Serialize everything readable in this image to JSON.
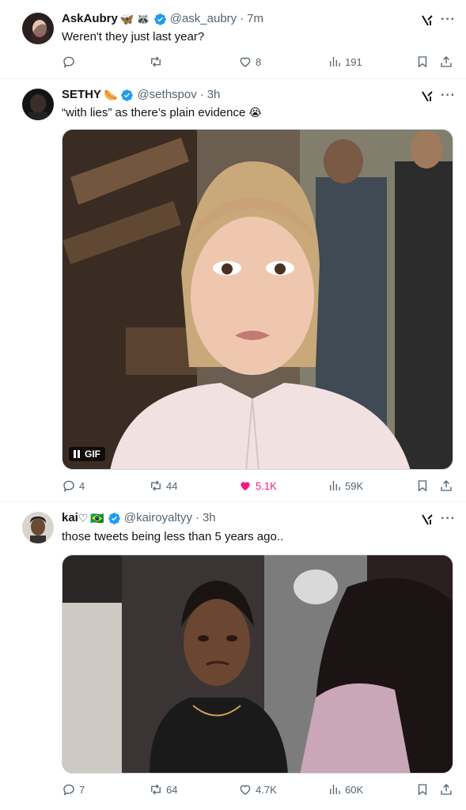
{
  "tweets": [
    {
      "name": "AskAubry",
      "emojis": [
        "🦋",
        "🦝"
      ],
      "handle": "@ask_aubry",
      "time": "7m",
      "text": "Weren't they just last year?",
      "text_emoji": "",
      "replies": "",
      "retweets": "",
      "likes": "8",
      "views": "191",
      "has_media": false,
      "liked": false
    },
    {
      "name": "SETHY",
      "emojis": [
        "🌭"
      ],
      "handle": "@sethspov",
      "time": "3h",
      "text": "“with lies” as there’s plain evidence",
      "text_emoji": "😭",
      "replies": "4",
      "retweets": "44",
      "likes": "5.1K",
      "views": "59K",
      "has_media": true,
      "media_badge": "GIF",
      "liked": true
    },
    {
      "name": "kai",
      "emojis": [
        "♡",
        "🇧🇷"
      ],
      "handle": "@kairoyaltyy",
      "time": "3h",
      "text": "those tweets being less than 5 years ago..",
      "text_emoji": "",
      "replies": "7",
      "retweets": "64",
      "likes": "4.7K",
      "views": "60K",
      "has_media": true,
      "liked": false
    }
  ],
  "ui": {
    "separator": "·",
    "more": "···"
  },
  "colors": {
    "verified": "#1d9bf0",
    "secondary_text": "#536471",
    "like_active": "#f91880"
  }
}
